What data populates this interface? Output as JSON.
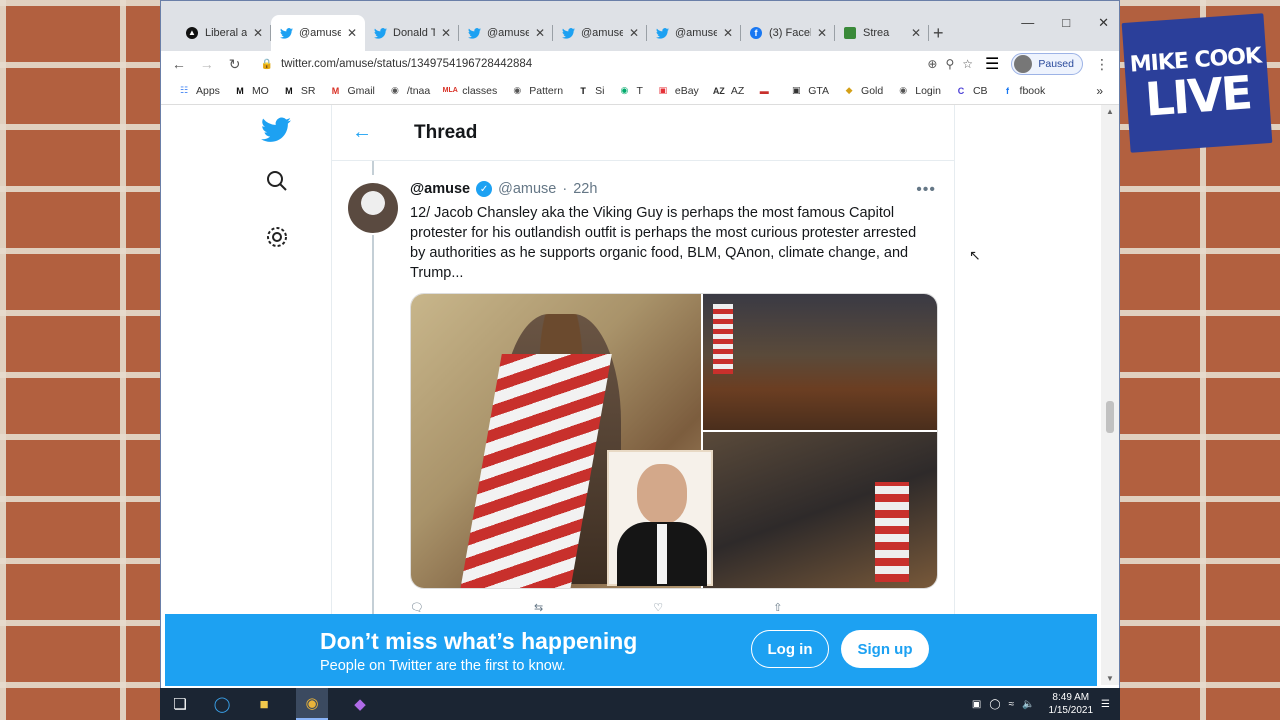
{
  "overlay": {
    "logo_line1": "MIKE COOK",
    "logo_line2": "LIVE"
  },
  "browser": {
    "tabs": [
      {
        "label": "Liberal a",
        "icon": "threads-icon",
        "active": false
      },
      {
        "label": "@amuse",
        "icon": "twitter-icon",
        "active": true
      },
      {
        "label": "Donald T",
        "icon": "twitter-icon",
        "active": false
      },
      {
        "label": "@amuse",
        "icon": "twitter-icon",
        "active": false
      },
      {
        "label": "@amuse",
        "icon": "twitter-icon",
        "active": false
      },
      {
        "label": "@amuse",
        "icon": "twitter-icon",
        "active": false
      },
      {
        "label": "(3) Faceb",
        "icon": "facebook-icon",
        "active": false
      },
      {
        "label": "Strea",
        "icon": "stream-icon",
        "active": false
      }
    ],
    "url": "twitter.com/amuse/status/1349754196728442884",
    "profile_status": "Paused",
    "bookmarks": [
      {
        "label": "Apps",
        "icon": "apps-icon",
        "color": "#4285f4"
      },
      {
        "label": "MO",
        "icon": "m-icon",
        "color": "#111111"
      },
      {
        "label": "SR",
        "icon": "m-icon",
        "color": "#111111"
      },
      {
        "label": "Gmail",
        "icon": "gmail-icon",
        "color": "#d93025"
      },
      {
        "label": "/tnaa",
        "icon": "globe-icon",
        "color": "#555555"
      },
      {
        "label": "classes",
        "icon": "mla-icon",
        "color": "#d93025"
      },
      {
        "label": "Pattern",
        "icon": "globe-icon",
        "color": "#555555"
      },
      {
        "label": "Si",
        "icon": "tesla-icon",
        "color": "#111111"
      },
      {
        "label": "T",
        "icon": "trip-icon",
        "color": "#00aa6c"
      },
      {
        "label": "eBay",
        "icon": "bag-icon",
        "color": "#e53238"
      },
      {
        "label": "AZ",
        "icon": "az-icon",
        "color": "#333333"
      },
      {
        "label": "",
        "icon": "flag-icon",
        "color": "#c8302c"
      },
      {
        "label": "GTA",
        "icon": "gta-icon",
        "color": "#333333"
      },
      {
        "label": "Gold",
        "icon": "gold-icon",
        "color": "#d4a017"
      },
      {
        "label": "Login",
        "icon": "globe-icon",
        "color": "#555555"
      },
      {
        "label": "CB",
        "icon": "cb-icon",
        "color": "#4b3fd6"
      },
      {
        "label": "fbook",
        "icon": "facebook-icon",
        "color": "#1877f2"
      }
    ]
  },
  "twitter": {
    "thread_title": "Thread",
    "tweet": {
      "name": "@amuse",
      "handle": "@amuse",
      "dot": "·",
      "time": "22h",
      "text": "12/ Jacob Chansley aka the Viking Guy is perhaps the most famous Capitol protester for his outlandish outfit is perhaps the most curious protester arrested by authorities as he supports organic food, BLM, QAnon, climate change, and Trump..."
    },
    "banner": {
      "title": "Don’t miss what’s happening",
      "subtitle": "People on Twitter are the first to know.",
      "login_label": "Log in",
      "signup_label": "Sign up"
    },
    "accent": "#1da1f2"
  },
  "taskbar": {
    "time": "8:49 AM",
    "date": "1/15/2021"
  }
}
